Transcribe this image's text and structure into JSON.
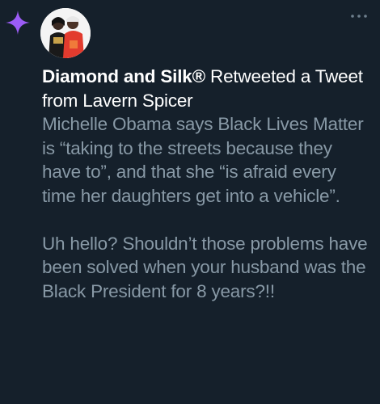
{
  "icons": {
    "sparkle": "sparkle-icon",
    "more": "more-options-icon"
  },
  "colors": {
    "background": "#15202b",
    "sparkle": "#9b5cf6",
    "primary_text": "#ffffff",
    "secondary_text": "#8899a6"
  },
  "retweet": {
    "name": "Diamond and Silk®",
    "action": " Retweeted a Tweet from Lavern Spicer"
  },
  "tweet": {
    "text": "Michelle Obama says Black Lives Matter is “taking to the streets because they have to”, and that she “is afraid every time her daughters get into a vehicle”.\n\nUh hello? Shouldn’t those problems have been solved when your husband was the Black President for 8 years?!!"
  }
}
